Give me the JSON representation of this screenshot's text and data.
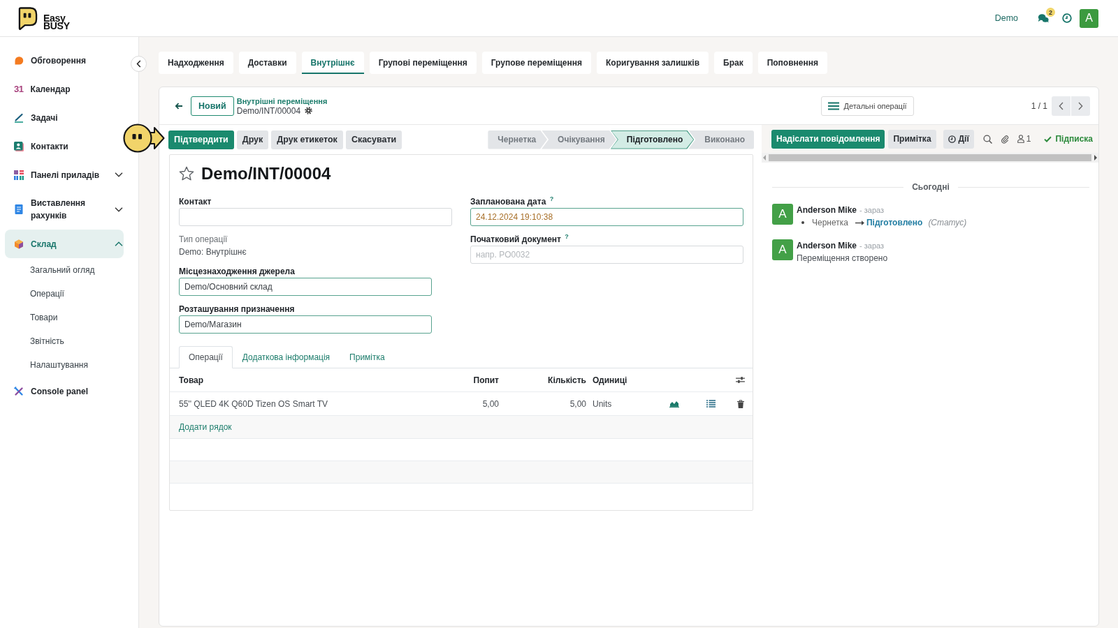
{
  "header": {
    "logo": [
      "Easy",
      "BUSY"
    ],
    "company": "Demo",
    "messages_badge": "2",
    "avatar_letter": "A"
  },
  "sidebar": {
    "items": [
      {
        "label": "Обговорення",
        "kind": "link",
        "selected": false
      },
      {
        "label": "Календар",
        "kind": "link",
        "selected": false,
        "icon_text": "31"
      },
      {
        "label": "Задачі",
        "kind": "link",
        "selected": false
      },
      {
        "label": "Контакти",
        "kind": "link",
        "selected": false
      },
      {
        "label": "Панелі приладів",
        "kind": "group",
        "selected": false,
        "expanded": false
      },
      {
        "label": "Виставлення рахунків",
        "kind": "group",
        "selected": false,
        "expanded": false
      },
      {
        "label": "Склад",
        "kind": "group",
        "selected": true,
        "expanded": true,
        "children": [
          {
            "label": "Загальний огляд",
            "selected": false
          },
          {
            "label": "Операції",
            "selected": false
          },
          {
            "label": "Товари",
            "selected": false
          },
          {
            "label": "Звітність",
            "selected": false
          },
          {
            "label": "Налаштування",
            "selected": false
          }
        ]
      },
      {
        "label": "Console panel",
        "kind": "link",
        "selected": false
      }
    ]
  },
  "tabs": [
    {
      "label": "Надходження",
      "selected": false
    },
    {
      "label": "Доставки",
      "selected": false
    },
    {
      "label": "Внутрішнє",
      "selected": true
    },
    {
      "label": "Групові переміщення",
      "selected": false
    },
    {
      "label": "Групове переміщення",
      "selected": false
    },
    {
      "label": "Коригування залишків",
      "selected": false
    },
    {
      "label": "Брак",
      "selected": false
    },
    {
      "label": "Поповнення",
      "selected": false
    }
  ],
  "control_panel": {
    "new_button": "Новий",
    "breadcrumb": "Внутрішні переміщення",
    "record": "Demo/INT/00004",
    "details_button": "Детальні операції",
    "pager": "1 / 1"
  },
  "action_buttons": [
    {
      "label": "Підтвердити",
      "kind": "primary"
    },
    {
      "label": "Друк",
      "kind": "secondary"
    },
    {
      "label": "Друк етикеток",
      "kind": "secondary"
    },
    {
      "label": "Скасувати",
      "kind": "secondary"
    }
  ],
  "status_stages": [
    {
      "label": "Чернетка",
      "selected": false
    },
    {
      "label": "Очікування",
      "selected": false
    },
    {
      "label": "Підготовлено",
      "selected": true
    },
    {
      "label": "Виконано",
      "selected": false
    }
  ],
  "form": {
    "title": "Demo/INT/00004",
    "starred": false,
    "columns": [
      {
        "fields": [
          {
            "label": "Контакт",
            "kind": "text",
            "required": false
          },
          {
            "label": "Тип операції",
            "kind": "readonly",
            "value": "Demo: Внутрішнє"
          },
          {
            "label": "Місцезнаходження джерела",
            "kind": "many2one",
            "value": "Demo/Основний склад",
            "required": true,
            "warning": false
          },
          {
            "label": "Розташування призначення",
            "kind": "many2one",
            "value": "Demo/Магазин",
            "required": true,
            "warning": false
          }
        ]
      },
      {
        "fields": [
          {
            "label": "Запланована дата $^{?}$",
            "kind": "date",
            "value": "24.12.2024 19:10:38",
            "required": true,
            "warning": true
          },
          {
            "label": "Початковий документ $^{?}$",
            "kind": "text",
            "placeholder": "напр. PO0032",
            "required": false
          }
        ]
      }
    ],
    "notebook": [
      {
        "label": "Операції",
        "selected": true
      },
      {
        "label": "Додаткова інформація",
        "selected": false
      },
      {
        "label": "Примітка",
        "selected": false
      }
    ],
    "table": {
      "columns": [
        "Товар",
        "Попит",
        "Кількість",
        "Одиниці"
      ],
      "rows": [
        {
          "cells": [
            "55'' QLED 4K Q60D Tizen OS Smart TV",
            "5,00",
            "5,00",
            "Units"
          ]
        }
      ],
      "add_line": "Додати рядок"
    }
  },
  "chatter": {
    "send_button": "Надіслати повідомлення",
    "note_button": "Примітка",
    "activities_button": "Дії",
    "followers_count": "1",
    "follow_button": "Підписка",
    "following": true,
    "date_separator": "Сьогодні",
    "messages": [
      {
        "kind": "tracking",
        "avatar_letter": "A",
        "author": "Anderson Mike",
        "time": "- зараз",
        "old_value": "Чернетка",
        "new_value": "Підготовлено",
        "field": "(Статус)"
      },
      {
        "kind": "text",
        "avatar_letter": "A",
        "author": "Anderson Mike",
        "time": "- зараз",
        "body": "Переміщення створено"
      }
    ]
  }
}
